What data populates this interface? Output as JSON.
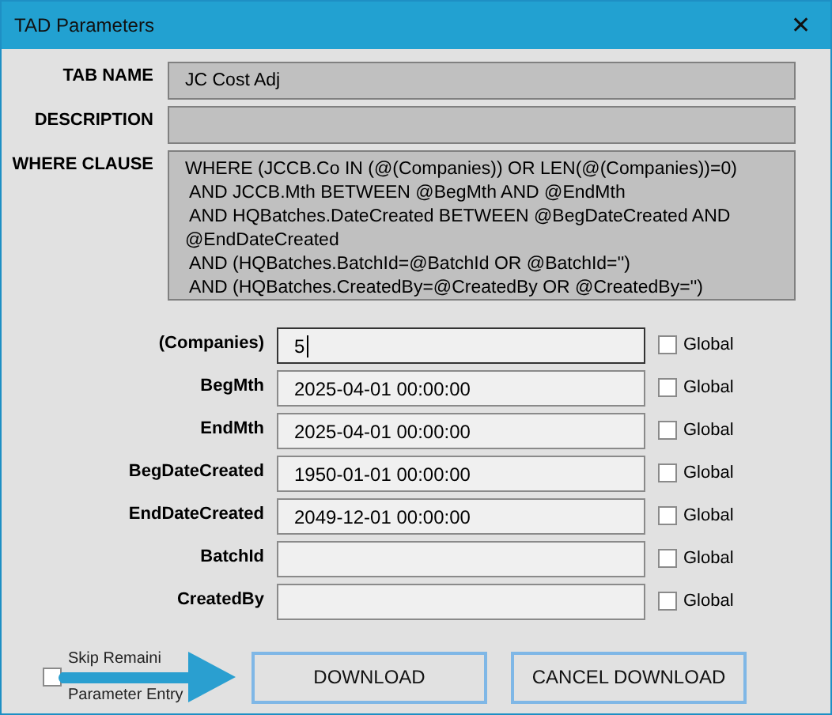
{
  "window": {
    "title": "TAD Parameters",
    "close": "✕"
  },
  "header_fields": [
    {
      "label": "TAB NAME",
      "value": "JC Cost Adj"
    },
    {
      "label": "DESCRIPTION"
    },
    {
      "label": "WHERE CLAUSE",
      "lines": [
        "WHERE (JCCB.Co IN (@(Companies)) OR LEN(@(Companies))=0)",
        " AND JCCB.Mth BETWEEN @BegMth AND @EndMth",
        " AND HQBatches.DateCreated BETWEEN @BegDateCreated AND",
        "@EndDateCreated",
        " AND (HQBatches.BatchId=@BatchId OR @BatchId='')",
        " AND (HQBatches.CreatedBy=@CreatedBy OR @CreatedBy='')"
      ]
    }
  ],
  "parameters": [
    {
      "label": "(Companies)",
      "value": "5",
      "focused": true,
      "global_label": "Global",
      "global": false
    },
    {
      "label": "BegMth",
      "value": "2025-04-01 00:00:00",
      "focused": false,
      "global_label": "Global",
      "global": false
    },
    {
      "label": "EndMth",
      "value": "2025-04-01 00:00:00",
      "focused": false,
      "global_label": "Global",
      "global": false
    },
    {
      "label": "BegDateCreated",
      "value": "1950-01-01 00:00:00",
      "focused": false,
      "global_label": "Global",
      "global": false
    },
    {
      "label": "EndDateCreated",
      "value": "2049-12-01 00:00:00",
      "focused": false,
      "global_label": "Global",
      "global": false
    },
    {
      "label": "BatchId",
      "focused": false,
      "global_label": "Global",
      "global": false
    },
    {
      "label": "CreatedBy",
      "focused": false,
      "global_label": "Global",
      "global": false
    }
  ],
  "skip": {
    "lines": [
      "Skip Remaini",
      "Parameter Entry"
    ],
    "checked": false
  },
  "buttons": [
    "DOWNLOAD",
    "CANCEL DOWNLOAD"
  ]
}
